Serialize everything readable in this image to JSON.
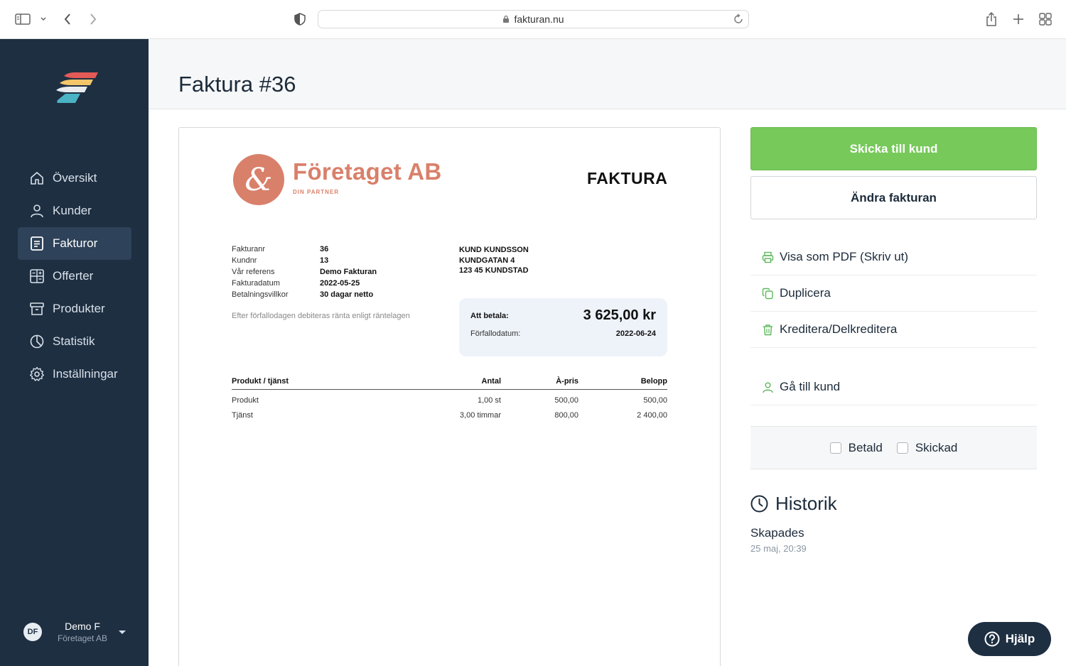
{
  "browser": {
    "url": "fakturan.nu"
  },
  "sidebar": {
    "items": [
      {
        "label": "Översikt",
        "icon": "home-icon"
      },
      {
        "label": "Kunder",
        "icon": "user-icon"
      },
      {
        "label": "Fakturor",
        "icon": "invoice-icon",
        "active": true
      },
      {
        "label": "Offerter",
        "icon": "calculator-icon"
      },
      {
        "label": "Produkter",
        "icon": "box-icon"
      },
      {
        "label": "Statistik",
        "icon": "pie-chart-icon"
      },
      {
        "label": "Inställningar",
        "icon": "gear-icon"
      }
    ],
    "user": {
      "initials": "DF",
      "name": "Demo F",
      "company": "Företaget AB"
    }
  },
  "header": {
    "title": "Faktura #36"
  },
  "invoice": {
    "logo": {
      "symbol": "&",
      "company": "Företaget AB",
      "tagline": "DIN PARTNER"
    },
    "doc_title": "FAKTURA",
    "meta": [
      {
        "label": "Fakturanr",
        "value": "36"
      },
      {
        "label": "Kundnr",
        "value": "13"
      },
      {
        "label": "Vår referens",
        "value": "Demo Fakturan"
      },
      {
        "label": "Fakturadatum",
        "value": "2022-05-25"
      },
      {
        "label": "Betalningsvillkor",
        "value": "30 dagar netto"
      }
    ],
    "interest_note": "Efter förfallodagen debiteras ränta enligt räntelagen",
    "customer": {
      "name": "KUND KUNDSSON",
      "street": "KUNDGATAN 4",
      "city": "123 45 KUNDSTAD"
    },
    "payment": {
      "label": "Att betala:",
      "amount": "3 625,00 kr",
      "due_label": "Förfallodatum:",
      "due_date": "2022-06-24"
    },
    "table": {
      "headers": {
        "product": "Produkt / tjänst",
        "qty": "Antal",
        "price": "À-pris",
        "sum": "Belopp"
      },
      "rows": [
        {
          "product": "Produkt",
          "qty": "1,00 st",
          "price": "500,00",
          "sum": "500,00"
        },
        {
          "product": "Tjänst",
          "qty": "3,00 timmar",
          "price": "800,00",
          "sum": "2 400,00"
        }
      ]
    }
  },
  "panel": {
    "send_label": "Skicka till kund",
    "edit_label": "Ändra fakturan",
    "actions": [
      {
        "label": "Visa som PDF (Skriv ut)",
        "icon": "printer-icon"
      },
      {
        "label": "Duplicera",
        "icon": "copy-icon"
      },
      {
        "label": "Kreditera/Delkreditera",
        "icon": "trash-icon"
      }
    ],
    "customer_link": {
      "label": "Gå till kund",
      "icon": "user-icon"
    },
    "status": {
      "paid_label": "Betald",
      "sent_label": "Skickad",
      "paid_checked": false,
      "sent_checked": false
    },
    "history": {
      "title": "Historik",
      "event": "Skapades",
      "time": "25 maj, 20:39"
    },
    "accent_color": "#77c95a"
  },
  "help": {
    "label": "Hjälp"
  }
}
